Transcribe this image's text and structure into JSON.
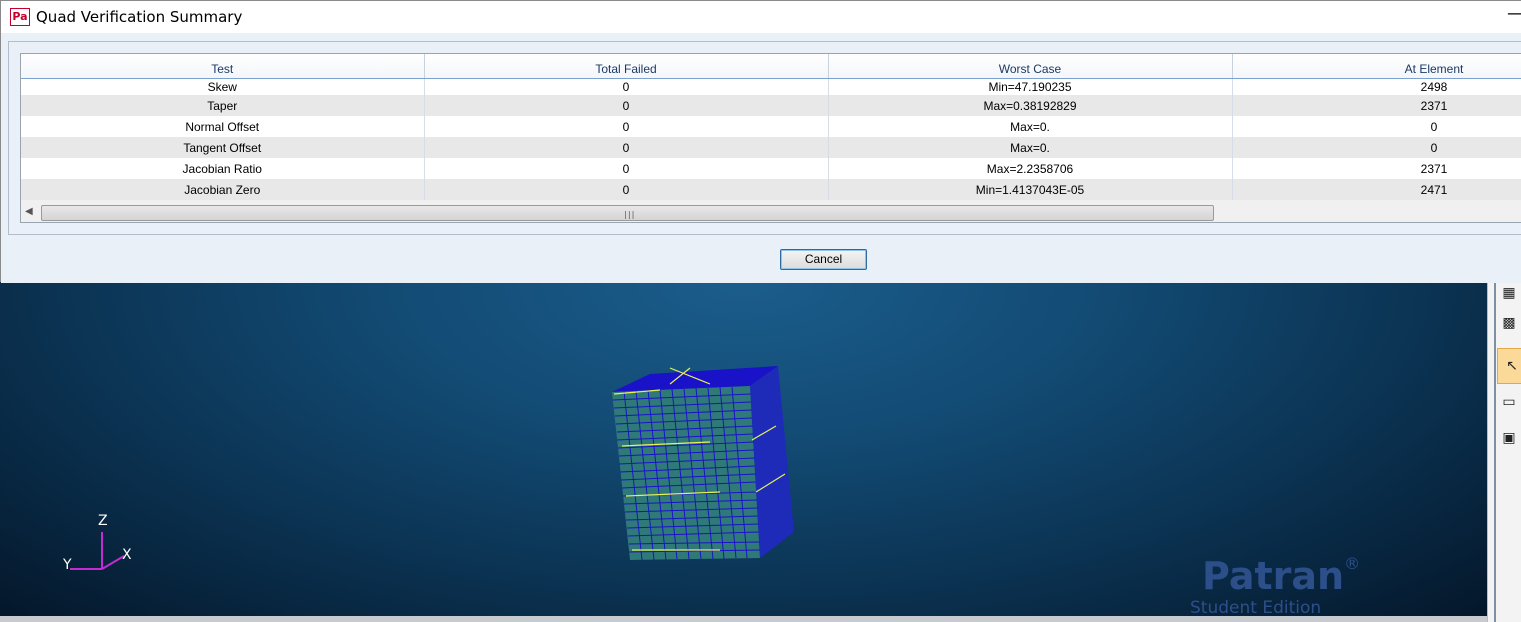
{
  "dialog": {
    "title": "Quad Verification Summary",
    "app_icon_text": "Pa",
    "minimize_glyph": "—",
    "columns": [
      "Test",
      "Total Failed",
      "Worst Case",
      "At Element"
    ],
    "rows": [
      [
        "Skew",
        "0",
        "Min=47.190235",
        "2498"
      ],
      [
        "Taper",
        "0",
        "Max=0.38192829",
        "2371"
      ],
      [
        "Normal Offset",
        "0",
        "Max=0.",
        "0"
      ],
      [
        "Tangent Offset",
        "0",
        "Max=0.",
        "0"
      ],
      [
        "Jacobian Ratio",
        "0",
        "Max=2.2358706",
        "2371"
      ],
      [
        "Jacobian Zero",
        "0",
        "Min=1.4137043E-05",
        "2471"
      ]
    ],
    "scroll_left_glyph": "◀",
    "scroll_grip": "|||",
    "cancel_label": "Cancel"
  },
  "viewport": {
    "axis_labels": {
      "z": "Z",
      "x": "X",
      "y": "Y"
    },
    "watermark_product": "Patran",
    "watermark_mark": "®",
    "watermark_edition": "Student Edition"
  },
  "toolbar": {
    "icons": [
      "grid-view-icon",
      "grid-view-2-icon",
      "select-arrow-icon",
      "folder-icon",
      "cube-icon"
    ]
  },
  "colors": {
    "viewport_top": "#1b5d8c",
    "viewport_bottom": "#04172a",
    "mesh_edges": "#1a12c8",
    "mesh_fill": "#2f7a78",
    "highlight": "#e5f25a",
    "axis": "#c42bd0",
    "toolbar_active": "#fbd999"
  }
}
